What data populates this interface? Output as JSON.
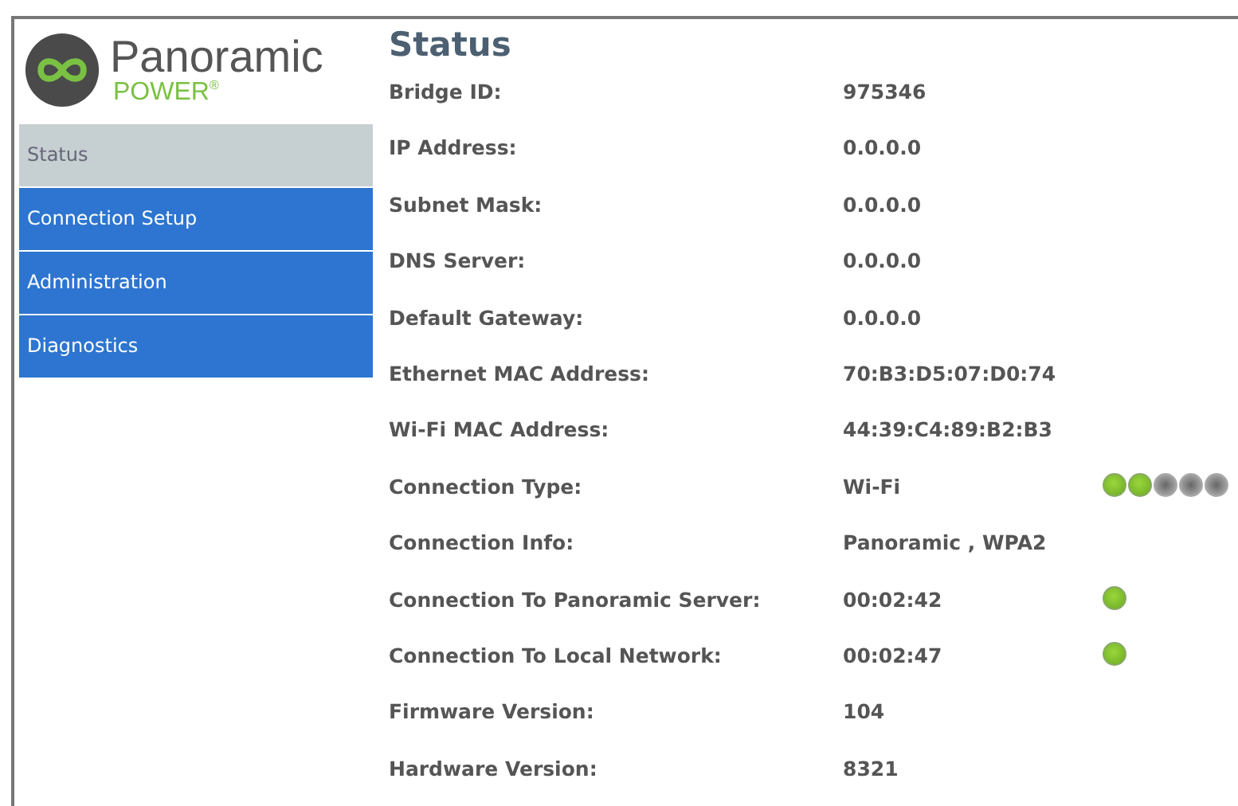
{
  "logo": {
    "name": "Panoramic",
    "tagline": "POWER",
    "mark": "®"
  },
  "nav": [
    {
      "label": "Status",
      "selected": true
    },
    {
      "label": "Connection Setup",
      "selected": false
    },
    {
      "label": "Administration",
      "selected": false
    },
    {
      "label": "Diagnostics",
      "selected": false
    }
  ],
  "title": "Status",
  "rows": [
    {
      "label": "Bridge ID:",
      "value": "975346"
    },
    {
      "label": "IP Address:",
      "value": "0.0.0.0"
    },
    {
      "label": "Subnet Mask:",
      "value": "0.0.0.0"
    },
    {
      "label": "DNS Server:",
      "value": "0.0.0.0"
    },
    {
      "label": "Default Gateway:",
      "value": "0.0.0.0"
    },
    {
      "label": "Ethernet MAC Address:",
      "value": "70:B3:D5:07:D0:74"
    },
    {
      "label": "Wi-Fi MAC Address:",
      "value": "44:39:C4:89:B2:B3"
    },
    {
      "label": "Connection Type:",
      "value": "Wi-Fi",
      "kind": "signal",
      "dots": [
        {
          "on": true
        },
        {
          "on": true
        },
        {
          "on": false
        },
        {
          "on": false
        },
        {
          "on": false
        }
      ]
    },
    {
      "label": "Connection Info:",
      "value": "Panoramic , WPA2"
    },
    {
      "label": "Connection To Panoramic Server:",
      "value": "00:02:42",
      "kind": "status",
      "on": true
    },
    {
      "label": "Connection To Local Network:",
      "value": "00:02:47",
      "kind": "status",
      "on": true
    },
    {
      "label": "Firmware Version:",
      "value": "104"
    },
    {
      "label": "Hardware Version:",
      "value": "8321"
    }
  ]
}
